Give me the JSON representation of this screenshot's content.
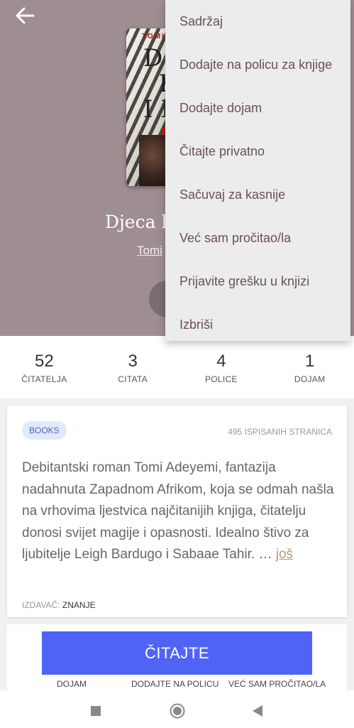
{
  "header": {
    "back_icon": "arrow-left-icon"
  },
  "book": {
    "title": "Djeca k",
    "author": "Tomi",
    "cover_author": "TOMI",
    "cover_letters": "D J\n  K\nI K"
  },
  "menu": {
    "items": [
      "Sadržaj",
      "Dodajte na policu za knjige",
      "Dodajte dojam",
      "Čitajte privatno",
      "Sačuvaj za kasnije",
      "Već sam pročitao/la",
      "Prijavite grešku u knjizi",
      "Izbriši"
    ]
  },
  "stats": [
    {
      "value": "52",
      "label": "ČITATELJA"
    },
    {
      "value": "3",
      "label": "CITATA"
    },
    {
      "value": "4",
      "label": "POLICE"
    },
    {
      "value": "1",
      "label": "DOJAM"
    }
  ],
  "details": {
    "badge": "BOOKS",
    "pages": "495 ISPISANIH STRANICA",
    "description": "Debitantski roman Tomi Adeyemi, fantazija nadahnuta Zapadnom Afrikom, koja se odmah našla na vrhovima ljestvica najčitanijih knjiga, čitatelju donosi svijet magije i opasnosti. Idealno štivo za ljubitelje Leigh Bardugo i Sabaae Tahir. …",
    "more_link": "još",
    "publisher_label": "IZDAVAČ:",
    "publisher_name": "ZNANJE"
  },
  "actions": {
    "read_label": "ČITAJTE",
    "dojam": "DOJAM",
    "add_shelf": "DODAJTE NA POLICU",
    "already_read": "VEĆ SAM PROČITAO/LA"
  },
  "colors": {
    "hero_bg": "#9e8d91",
    "accent_button": "#4f63f5",
    "badge_bg": "#e2e9fb",
    "badge_text": "#4a64c7",
    "menu_text": "#6b5150"
  }
}
